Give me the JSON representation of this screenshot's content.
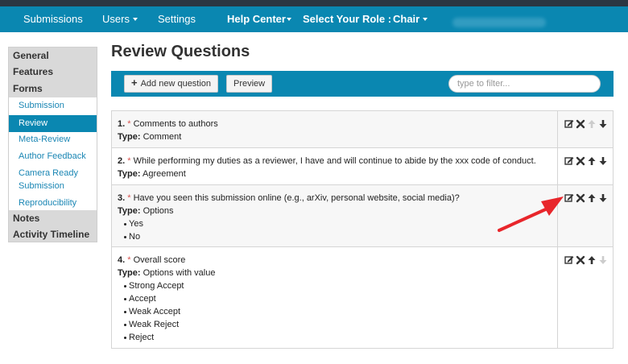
{
  "navbar": {
    "submissions": "Submissions",
    "users": "Users",
    "settings": "Settings",
    "help_center": "Help Center",
    "select_role": "Select Your Role :",
    "role": "Chair"
  },
  "sidebar": {
    "general": "General",
    "features": "Features",
    "forms": "Forms",
    "form_items": [
      {
        "label": "Submission"
      },
      {
        "label": "Review",
        "active": true
      },
      {
        "label": "Meta-Review"
      },
      {
        "label": "Author Feedback"
      },
      {
        "label": "Camera Ready"
      },
      {
        "label": "Submission"
      },
      {
        "label": "Reproducibility"
      }
    ],
    "notes": "Notes",
    "activity_timeline": "Activity Timeline"
  },
  "main": {
    "title": "Review Questions",
    "add_button": "Add new question",
    "preview_button": "Preview",
    "filter_placeholder": "type to filter..."
  },
  "questions": [
    {
      "num": "1.",
      "required": "*",
      "text": "Comments to authors",
      "type_label": "Type:",
      "type": "Comment",
      "options": []
    },
    {
      "num": "2.",
      "required": "*",
      "text": "While performing my duties as a reviewer, I have and will continue to abide by the xxx code of conduct.",
      "type_label": "Type:",
      "type": "Agreement",
      "options": []
    },
    {
      "num": "3.",
      "required": "*",
      "text": "Have you seen this submission online (e.g., arXiv, personal website, social media)?",
      "type_label": "Type:",
      "type": "Options",
      "options": [
        "Yes",
        "No"
      ]
    },
    {
      "num": "4.",
      "required": "*",
      "text": "Overall score",
      "type_label": "Type:",
      "type": "Options with value",
      "options": [
        "Strong Accept",
        "Accept",
        "Weak Accept",
        "Weak Reject",
        "Reject"
      ]
    }
  ],
  "colors": {
    "nav_bg": "#0a87b1",
    "top_strip": "#2b3642",
    "accent_link": "#1a86b4",
    "required": "#d9534f",
    "annotation_arrow": "#e8262b"
  },
  "icons": [
    "plus-icon",
    "edit-icon",
    "delete-icon",
    "arrow-up-icon",
    "arrow-down-icon",
    "annotation-arrow"
  ]
}
